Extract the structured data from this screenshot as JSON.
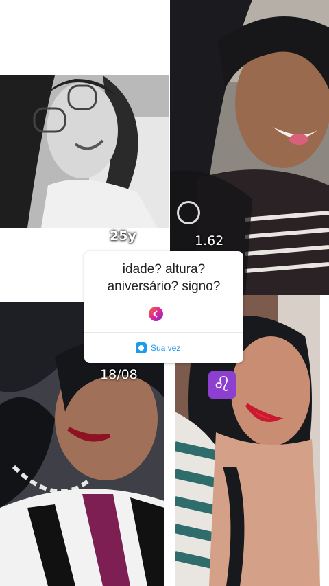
{
  "story": {
    "labels": {
      "age": "25y",
      "height": "1.62",
      "birthday": "18/08"
    },
    "question_card": {
      "question": "idade? altura?\naniversário? signo?",
      "reply_button": "Sua vez",
      "icon": "reply-arrow-icon",
      "button_icon": "camera-icon",
      "accent": "#1a9bf0"
    },
    "sticker": {
      "zodiac_symbol": "♌",
      "color": "#8d3fd0"
    }
  }
}
